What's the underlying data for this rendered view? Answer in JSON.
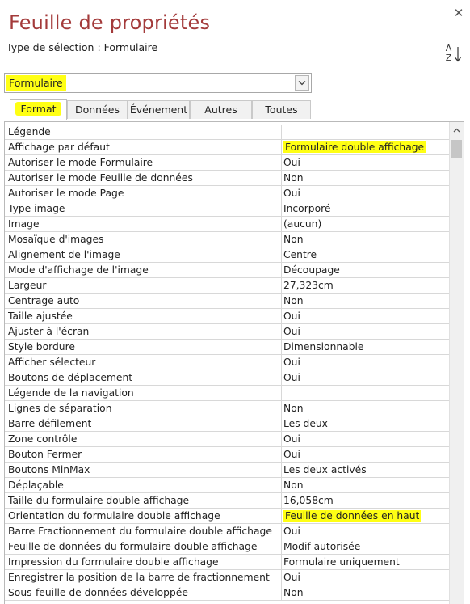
{
  "window": {
    "title": "Feuille de propriétés",
    "selection_type": "Type de sélection :  Formulaire"
  },
  "selector": {
    "value": "Formulaire"
  },
  "tabs": [
    {
      "label": "Format"
    },
    {
      "label": "Données"
    },
    {
      "label": "Événement"
    },
    {
      "label": "Autres"
    },
    {
      "label": "Toutes"
    }
  ],
  "sort": {
    "top": "A",
    "bottom": "Z"
  },
  "properties": [
    {
      "label": "Légende",
      "value": ""
    },
    {
      "label": "Affichage par défaut",
      "value": "Formulaire double affichage"
    },
    {
      "label": "Autoriser le mode Formulaire",
      "value": "Oui"
    },
    {
      "label": "Autoriser le mode Feuille de données",
      "value": "Non"
    },
    {
      "label": "Autoriser le mode Page",
      "value": "Oui"
    },
    {
      "label": "Type image",
      "value": "Incorporé"
    },
    {
      "label": "Image",
      "value": "(aucun)"
    },
    {
      "label": "Mosaïque d'images",
      "value": "Non"
    },
    {
      "label": "Alignement de l'image",
      "value": "Centre"
    },
    {
      "label": "Mode d'affichage de l'image",
      "value": "Découpage"
    },
    {
      "label": "Largeur",
      "value": "27,323cm"
    },
    {
      "label": "Centrage auto",
      "value": "Non"
    },
    {
      "label": "Taille ajustée",
      "value": "Oui"
    },
    {
      "label": "Ajuster à l'écran",
      "value": "Oui"
    },
    {
      "label": "Style bordure",
      "value": "Dimensionnable"
    },
    {
      "label": "Afficher sélecteur",
      "value": "Oui"
    },
    {
      "label": "Boutons de déplacement",
      "value": "Oui"
    },
    {
      "label": "Légende de la navigation",
      "value": ""
    },
    {
      "label": "Lignes de séparation",
      "value": "Non"
    },
    {
      "label": "Barre défilement",
      "value": "Les deux"
    },
    {
      "label": "Zone contrôle",
      "value": "Oui"
    },
    {
      "label": "Bouton Fermer",
      "value": "Oui"
    },
    {
      "label": "Boutons MinMax",
      "value": "Les deux activés"
    },
    {
      "label": "Déplaçable",
      "value": "Non"
    },
    {
      "label": "Taille du formulaire double affichage",
      "value": "16,058cm"
    },
    {
      "label": "Orientation du formulaire double affichage",
      "value": "Feuille de données en haut"
    },
    {
      "label": "Barre Fractionnement du formulaire double affichage",
      "value": "Oui"
    },
    {
      "label": "Feuille de données du formulaire double affichage",
      "value": "Modif autorisée"
    },
    {
      "label": "Impression du formulaire double affichage",
      "value": "Formulaire uniquement"
    },
    {
      "label": "Enregistrer la position de la barre de fractionnement",
      "value": "Oui"
    },
    {
      "label": "Sous-feuille de données développée",
      "value": "Non"
    }
  ],
  "colors": {
    "title": "#a33a3a",
    "highlight": "#ffff14"
  }
}
